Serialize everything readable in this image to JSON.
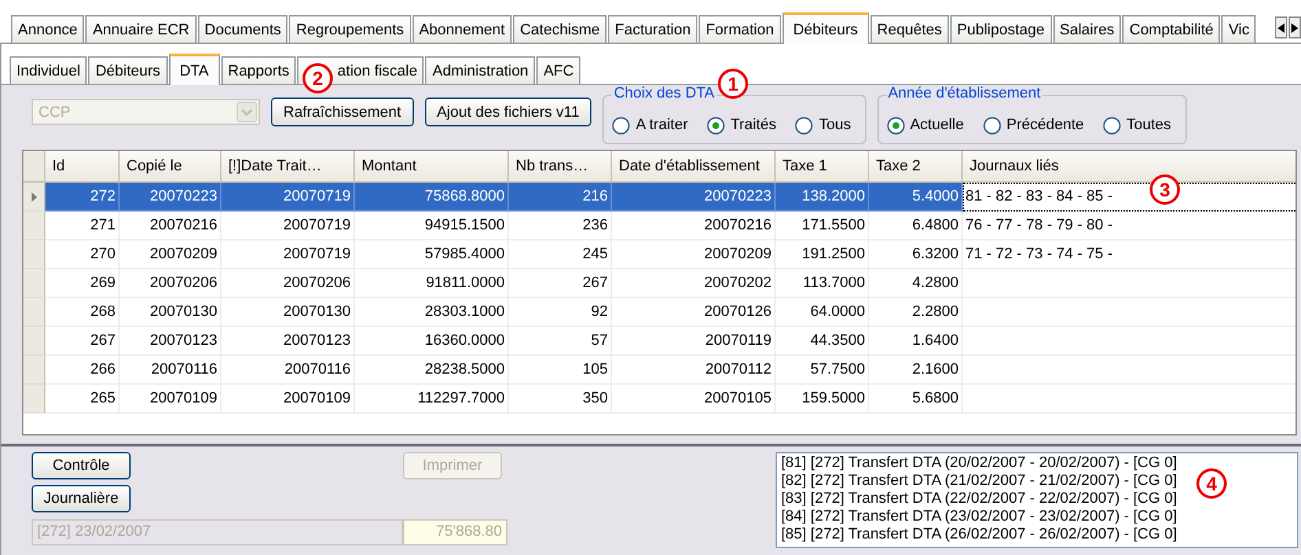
{
  "main_tabs": [
    {
      "label": "Annonce",
      "selected": false
    },
    {
      "label": "Annuaire ECR",
      "selected": false
    },
    {
      "label": "Documents",
      "selected": false
    },
    {
      "label": "Regroupements",
      "selected": false
    },
    {
      "label": "Abonnement",
      "selected": false
    },
    {
      "label": "Catechisme",
      "selected": false
    },
    {
      "label": "Facturation",
      "selected": false
    },
    {
      "label": "Formation",
      "selected": false
    },
    {
      "label": "Débiteurs",
      "selected": true
    },
    {
      "label": "Requêtes",
      "selected": false
    },
    {
      "label": "Publipostage",
      "selected": false
    },
    {
      "label": "Salaires",
      "selected": false
    },
    {
      "label": "Comptabilité",
      "selected": false
    },
    {
      "label": "Vic",
      "selected": false
    }
  ],
  "sub_tabs": [
    {
      "label": "Individuel",
      "selected": false
    },
    {
      "label": "Débiteurs",
      "selected": false
    },
    {
      "label": "DTA",
      "selected": true
    },
    {
      "label": "Rapports",
      "selected": false
    },
    {
      "label": "ation fiscale",
      "selected": false
    },
    {
      "label": "Administration",
      "selected": false
    },
    {
      "label": "AFC",
      "selected": false
    }
  ],
  "toolbar": {
    "account_combo": {
      "value": "CCP",
      "disabled": true
    },
    "buttons": [
      "Rafraîchissement",
      "Ajout des fichiers v11"
    ]
  },
  "dta_filter": {
    "title": "Choix des DTA",
    "options": [
      {
        "label": "A traiter",
        "selected": false
      },
      {
        "label": "Traités",
        "selected": true
      },
      {
        "label": "Tous",
        "selected": false
      }
    ]
  },
  "year_filter": {
    "title": "Année d'établissement",
    "options": [
      {
        "label": "Actuelle",
        "selected": true
      },
      {
        "label": "Précédente",
        "selected": false
      },
      {
        "label": "Toutes",
        "selected": false
      }
    ]
  },
  "table": {
    "columns": [
      "Id",
      "Copié le",
      "[!]Date Trait…",
      "Montant",
      "Nb trans…",
      "Date d'établissement",
      "Taxe 1",
      "Taxe 2",
      "Journaux liés"
    ],
    "rows": [
      {
        "selected": true,
        "cells": [
          "272",
          "20070223",
          "20070719",
          "75868.8000",
          "216",
          "20070223",
          "138.2000",
          "5.4000",
          "81 - 82 - 83 - 84 - 85 -"
        ]
      },
      {
        "selected": false,
        "cells": [
          "271",
          "20070216",
          "20070719",
          "94915.1500",
          "236",
          "20070216",
          "171.5500",
          "6.4800",
          "76 - 77 - 78 - 79 - 80 -"
        ]
      },
      {
        "selected": false,
        "cells": [
          "270",
          "20070209",
          "20070719",
          "57985.4000",
          "245",
          "20070209",
          "191.2500",
          "6.3200",
          "71 - 72 - 73 - 74 - 75 -"
        ]
      },
      {
        "selected": false,
        "cells": [
          "269",
          "20070206",
          "20070206",
          "91811.0000",
          "267",
          "20070202",
          "113.7000",
          "4.2800",
          ""
        ]
      },
      {
        "selected": false,
        "cells": [
          "268",
          "20070130",
          "20070130",
          "28303.1000",
          "92",
          "20070126",
          "64.0000",
          "2.2800",
          ""
        ]
      },
      {
        "selected": false,
        "cells": [
          "267",
          "20070123",
          "20070123",
          "16360.0000",
          "57",
          "20070119",
          "44.3500",
          "1.6400",
          ""
        ]
      },
      {
        "selected": false,
        "cells": [
          "266",
          "20070116",
          "20070116",
          "28238.5000",
          "105",
          "20070112",
          "57.7500",
          "2.1600",
          ""
        ]
      },
      {
        "selected": false,
        "cells": [
          "265",
          "20070109",
          "20070109",
          "112297.7000",
          "350",
          "20070105",
          "159.5000",
          "5.6800",
          ""
        ]
      }
    ]
  },
  "bottom": {
    "buttons": [
      {
        "label": "Contrôle",
        "disabled": false
      },
      {
        "label": "Journalière",
        "disabled": false
      },
      {
        "label": "Imprimer",
        "disabled": true
      }
    ],
    "info_field": {
      "value": "[272] 23/02/2007"
    },
    "amount_field": {
      "value": "75'868.80"
    },
    "log": [
      "[81] [272] Transfert DTA (20/02/2007 - 20/02/2007) - [CG 0]",
      "[82] [272] Transfert DTA (21/02/2007 - 21/02/2007) - [CG 0]",
      "[83] [272] Transfert DTA (22/02/2007 - 22/02/2007) - [CG 0]",
      "[84] [272] Transfert DTA (23/02/2007 - 23/02/2007) - [CG 0]",
      "[85] [272] Transfert DTA (26/02/2007 - 26/02/2007) - [CG 0]"
    ]
  },
  "callouts": [
    {
      "label": "1"
    },
    {
      "label": "2"
    },
    {
      "label": "3"
    },
    {
      "label": "4"
    }
  ]
}
